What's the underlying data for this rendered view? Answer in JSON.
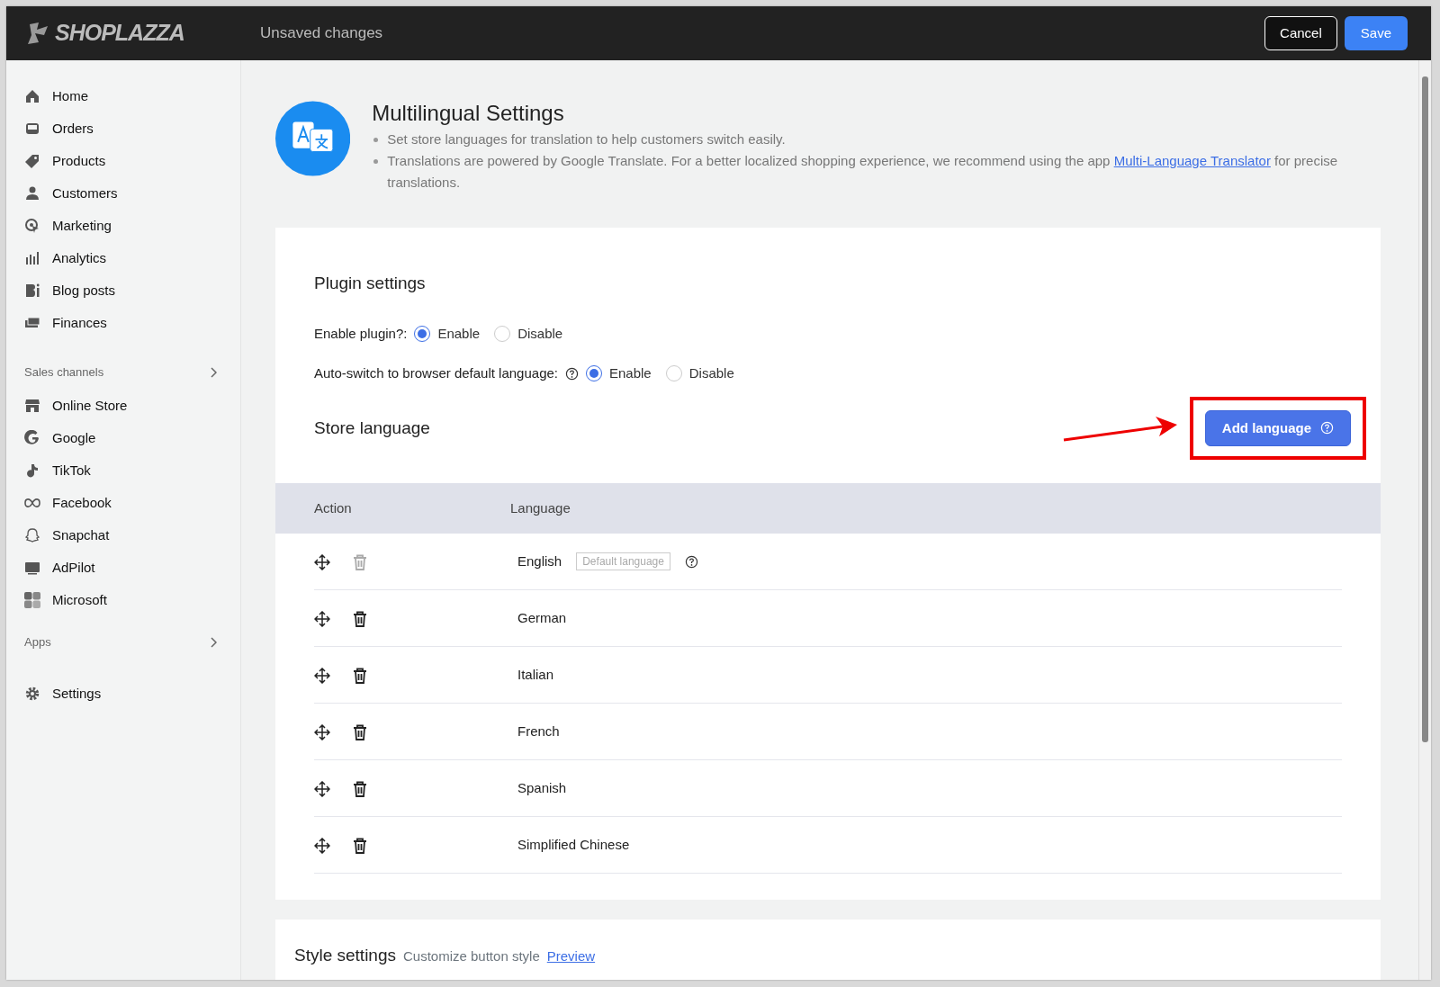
{
  "topbar": {
    "logo": "SHOPLAZZA",
    "status": "Unsaved changes",
    "buttons": [
      {
        "label": "Cancel",
        "kind": "outline"
      },
      {
        "label": "Save",
        "kind": "primary"
      }
    ]
  },
  "sidebar": {
    "sections": [
      {
        "items": [
          {
            "label": "Home"
          },
          {
            "label": "Orders"
          },
          {
            "label": "Products"
          },
          {
            "label": "Customers"
          },
          {
            "label": "Marketing"
          },
          {
            "label": "Analytics"
          },
          {
            "label": "Blog posts"
          },
          {
            "label": "Finances"
          }
        ]
      },
      {
        "heading": "Sales channels",
        "items": [
          {
            "label": "Online Store"
          },
          {
            "label": "Google"
          },
          {
            "label": "TikTok"
          },
          {
            "label": "Facebook"
          },
          {
            "label": "Snapchat"
          },
          {
            "label": "AdPilot"
          },
          {
            "label": "Microsoft"
          }
        ]
      },
      {
        "heading": "Apps"
      },
      {
        "items": [
          {
            "label": "Settings"
          }
        ]
      }
    ]
  },
  "header": {
    "title": "Multilingual Settings",
    "bullets": [
      "Set store languages for translation to help customers switch easily.",
      "Translations are powered by Google Translate. For a better localized shopping experience, we recommend using the app "
    ],
    "link": "Multi-Language Translator",
    "bullet_tail": " for precise translations."
  },
  "plugin_settings": {
    "title": "Plugin settings",
    "settings": [
      {
        "label": "Enable plugin?:",
        "help": false,
        "options": [
          {
            "label": "Enable",
            "selected": true
          },
          {
            "label": "Disable",
            "selected": false
          }
        ]
      },
      {
        "label": "Auto-switch to browser default language:",
        "help": true,
        "options": [
          {
            "label": "Enable",
            "selected": true
          },
          {
            "label": "Disable",
            "selected": false
          }
        ]
      }
    ]
  },
  "store_language": {
    "title": "Store language",
    "add_button": {
      "label": "Add language",
      "highlighted": true
    },
    "columns": [
      "Action",
      "Language"
    ],
    "rows": [
      {
        "language": "English",
        "deletable": false,
        "badge": "Default language"
      },
      {
        "language": "German",
        "deletable": true
      },
      {
        "language": "Italian",
        "deletable": true
      },
      {
        "language": "French",
        "deletable": true
      },
      {
        "language": "Spanish",
        "deletable": true
      },
      {
        "language": "Simplified Chinese",
        "deletable": true
      }
    ]
  },
  "style_settings": {
    "title": "Style settings",
    "subtitle": "Customize button style",
    "link": "Preview"
  }
}
